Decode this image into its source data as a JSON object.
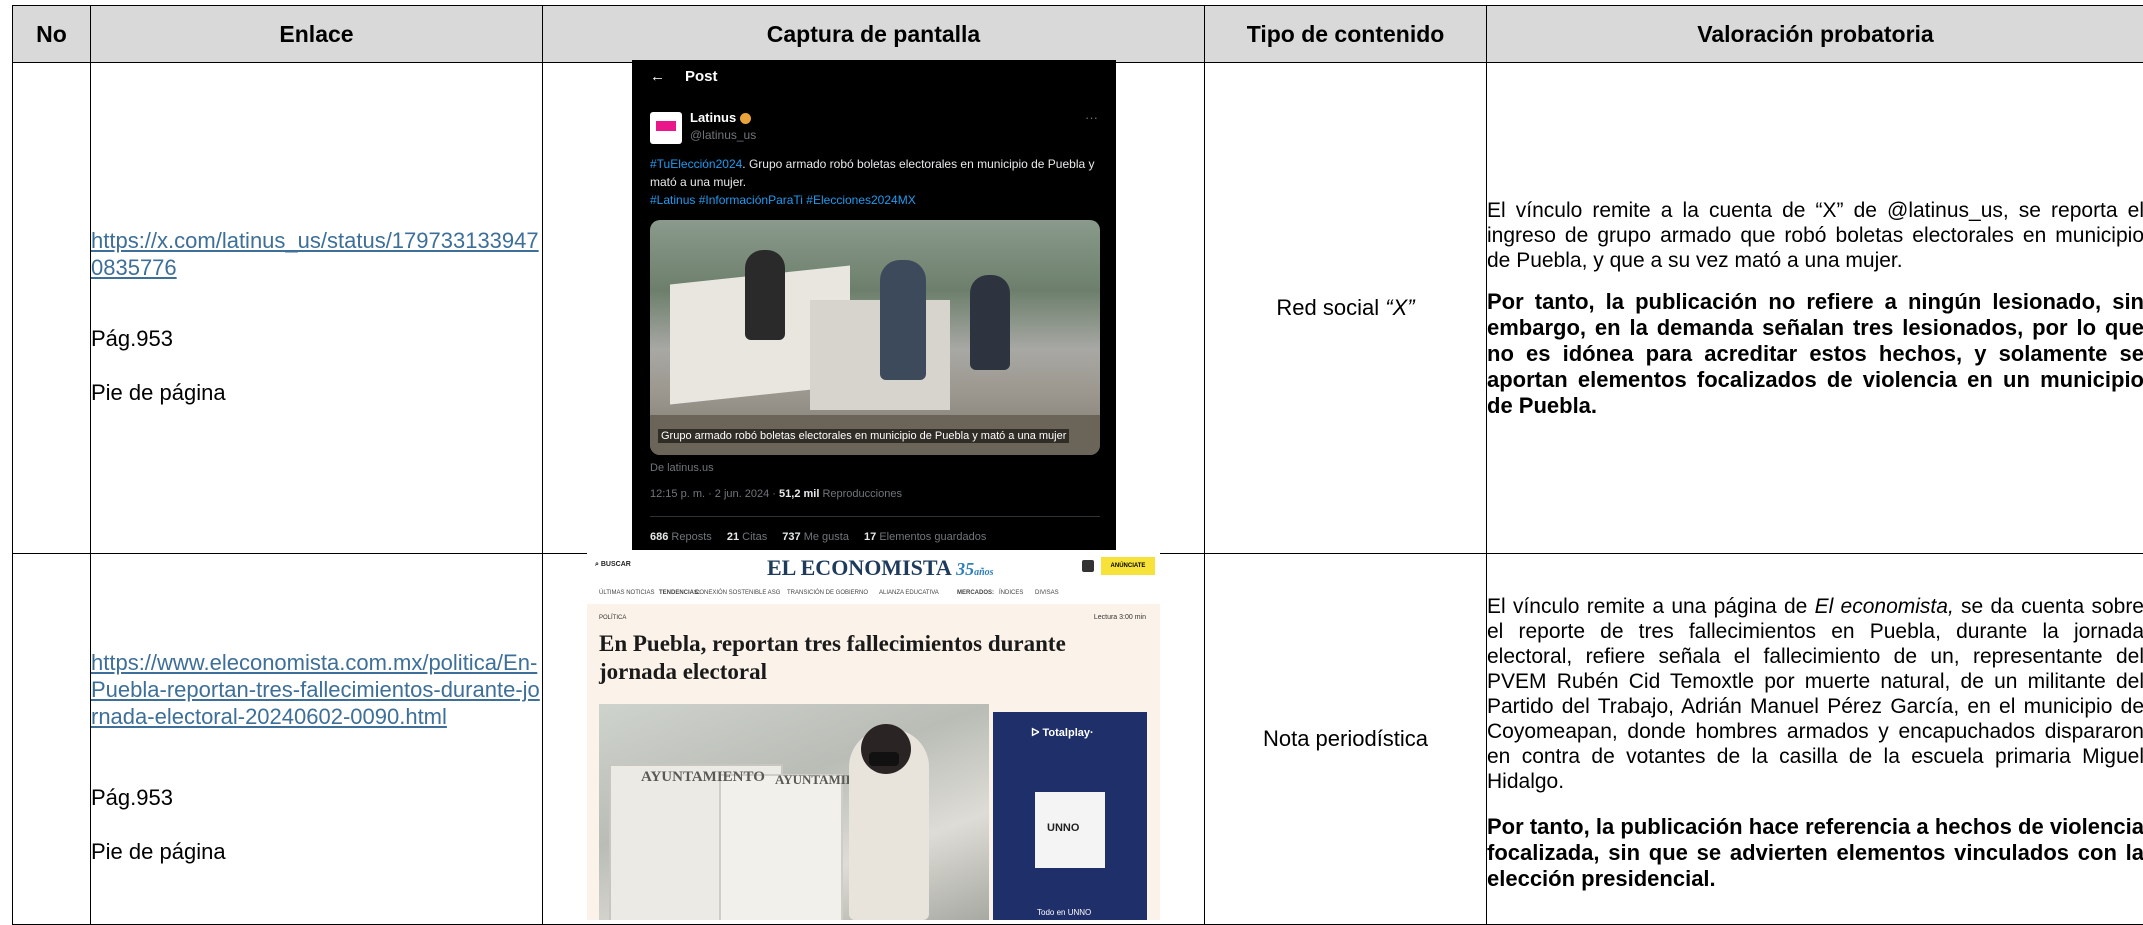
{
  "table": {
    "headers": [
      "No",
      "Enlace",
      "Captura de pantalla",
      "Tipo de contenido",
      "Valoración probatoria"
    ],
    "rows": [
      {
        "no": "",
        "link": "https://x.com/latinus_us/status/1797331339470835776",
        "page": "Pág.953",
        "note": "Pie de página",
        "type": "Red social",
        "type_italic": "“X”",
        "valuation": "El vínculo remite a la cuenta de “X” de @latinus_us, se reporta el ingreso de grupo armado que robó boletas electorales en municipio de Puebla, y que a su vez mató a una mujer.",
        "conclusion": "Por tanto, la publicación no refiere a ningún lesionado, sin embargo, en la demanda señalan tres lesionados, por lo que no es idónea para acreditar estos hechos, y solamente se aportan elementos focalizados de violencia en un municipio de Puebla."
      },
      {
        "no": "",
        "link": "https://www.eleconomista.com.mx/politica/En-Puebla-reportan-tres-fallecimientos-durante-jornada-electoral-20240602-0090.html",
        "page": "Pág.953",
        "note": "Pie de página",
        "type": "Nota periodística",
        "valuation_pre": "El vínculo remite a una página de ",
        "valuation_italic": "El economista,",
        "valuation_post": " se da cuenta sobre el reporte de tres fallecimientos en Puebla, durante la jornada electoral, refiere señala el fallecimiento de un, representante del PVEM Rubén Cid Temoxtle por muerte natural, de un militante del Partido del Trabajo, Adrián Manuel Pérez García, en el municipio de Coyomeapan, donde hombres armados y encapuchados dispararon en contra de votantes de la casilla de la escuela primaria Miguel Hidalgo.",
        "conclusion": "Por tanto, la publicación hace referencia a hechos de violencia focalizada, sin que se advierten elementos vinculados con la elección presidencial."
      }
    ]
  },
  "tweet": {
    "back_icon": "←",
    "title": "Post",
    "account": "Latinus",
    "handle": "@latinus_us",
    "more": "···",
    "hashtag_lead": "#TuElección2024",
    "text": ". Grupo armado robó boletas electorales en municipio de Puebla y mató a una mujer.",
    "hashtags": "#Latinus #InformaciónParaTi #Elecciones2024MX",
    "video_caption": "Grupo armado robó boletas electorales en municipio de Puebla y mató a una mujer",
    "source": "De latinus.us",
    "time": "12:15 p. m. · 2 jun. 2024 · ",
    "views_count": "51,2 mil",
    "views_label": " Reproducciones",
    "stats": [
      {
        "count": "686",
        "label": "Reposts"
      },
      {
        "count": "21",
        "label": "Citas"
      },
      {
        "count": "737",
        "label": "Me gusta"
      },
      {
        "count": "17",
        "label": "Elementos guardados"
      }
    ],
    "colors": {
      "background": "#000000",
      "link": "#1d9bf0",
      "verified": "#e8a33a",
      "avatar": "#e9178a"
    }
  },
  "economista": {
    "search": "⌕ BUSCAR",
    "logo": "EL ECONOMISTA",
    "anniversary": "35",
    "anniversary_suffix": "años",
    "advertise": "ANÚNCIATE",
    "nav": [
      "ÚLTIMAS NOTICIAS",
      "TENDENCIAS:",
      "CONEXIÓN SOSTENIBLE ASG",
      "TRANSICIÓN DE GOBIERNO",
      "ALIANZA EDUCATIVA",
      "MERCADOS:",
      "ÍNDICES",
      "DIVISAS"
    ],
    "section": "POLÍTICA",
    "reading": "Lectura 3:00 min",
    "headline": "En Puebla, reportan tres fallecimientos durante jornada electoral",
    "photo_label1": "AYUNTAMIENTO",
    "photo_label2": "AYUNTAMIENTO",
    "ad_brand": "ᐅ Totalplay·",
    "ad_product": "UNNO",
    "ad_footer": "Todo en UNNO",
    "colors": {
      "background": "#fbf3e9",
      "logo": "#1e3b5c",
      "accent": "#f7e23a",
      "ad": "#1f2f6a"
    }
  }
}
